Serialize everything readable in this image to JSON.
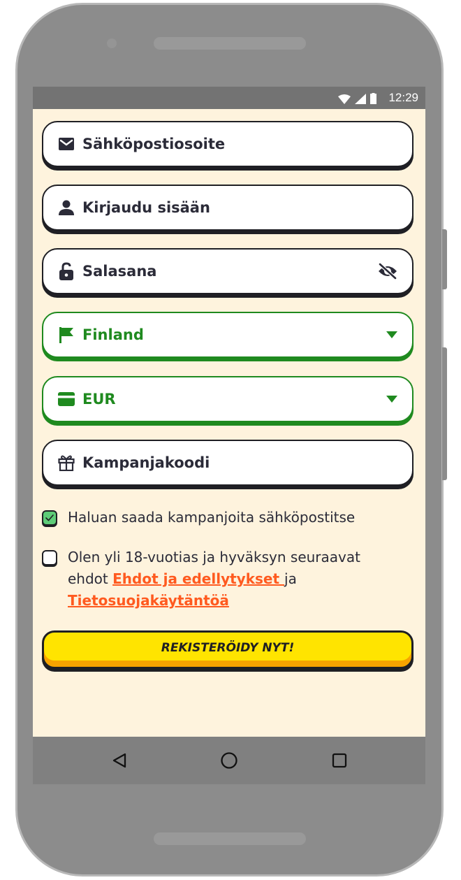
{
  "status_bar": {
    "time": "12:29"
  },
  "form": {
    "email": {
      "placeholder": "Sähköpostiosoite",
      "icon": "envelope-icon"
    },
    "username": {
      "placeholder": "Kirjaudu sisään",
      "icon": "user-icon"
    },
    "password": {
      "placeholder": "Salasana",
      "icon": "unlock-icon",
      "toggle_icon": "eye-slash-icon"
    },
    "country": {
      "value": "Finland",
      "icon": "flag-icon"
    },
    "currency": {
      "value": "EUR",
      "icon": "credit-card-icon"
    },
    "promo": {
      "placeholder": "Kampanjakoodi",
      "icon": "gift-icon"
    }
  },
  "consents": {
    "marketing": {
      "checked": true,
      "text": "Haluan saada kampanjoita sähköpostitse"
    },
    "terms": {
      "checked": false,
      "text_before": "Olen yli 18-vuotias ja hyväksyn seuraavat ehdot ",
      "terms_link": "Ehdot ja edellytykset ",
      "text_between": "ja",
      "privacy_link": "Tietosuojakäytäntöä"
    }
  },
  "register_button": {
    "label": "REKISTERÖIDY NYT!"
  },
  "colors": {
    "accent_green": "#1f8a1f",
    "link_orange": "#ff5a1f",
    "button_yellow": "#ffe400",
    "background": "#fef3dd"
  }
}
